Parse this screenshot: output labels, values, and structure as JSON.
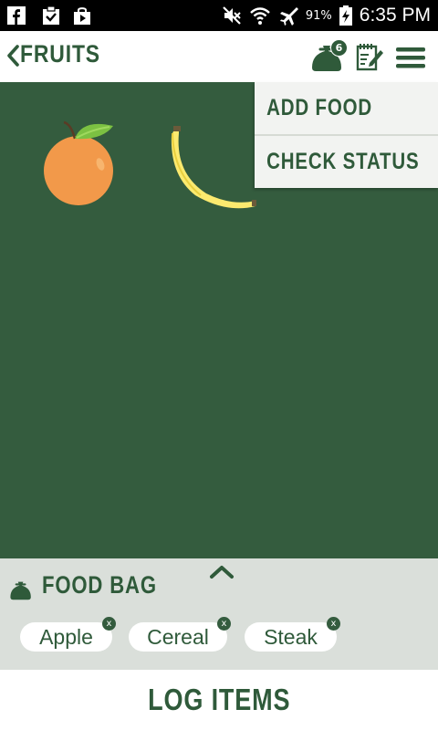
{
  "status_bar": {
    "notification_icons": [
      "facebook-icon",
      "clipboard-check-icon",
      "shopping-bag-icon"
    ],
    "indicator_icons": [
      "mute-icon",
      "wifi-icon",
      "airplane-mode-icon"
    ],
    "battery_percent": "91%",
    "time": "6:35 PM"
  },
  "app_bar": {
    "title": "FRUITS",
    "bag_count": "6"
  },
  "dropdown_menu": {
    "items": [
      "ADD FOOD",
      "CHECK STATUS"
    ]
  },
  "foods_on_canvas": [
    "orange",
    "banana"
  ],
  "food_bag": {
    "title": "FOOD BAG",
    "chips": [
      {
        "label": "Apple",
        "remove": "x"
      },
      {
        "label": "Cereal",
        "remove": "x"
      },
      {
        "label": "Steak",
        "remove": "x"
      }
    ]
  },
  "footer": {
    "action_label": "LOG ITEMS"
  },
  "colors": {
    "primary_green": "#2f5a3a",
    "canvas_green": "#345c3e",
    "bag_panel": "#dadfda",
    "menu_bg": "#f2f3f1"
  }
}
